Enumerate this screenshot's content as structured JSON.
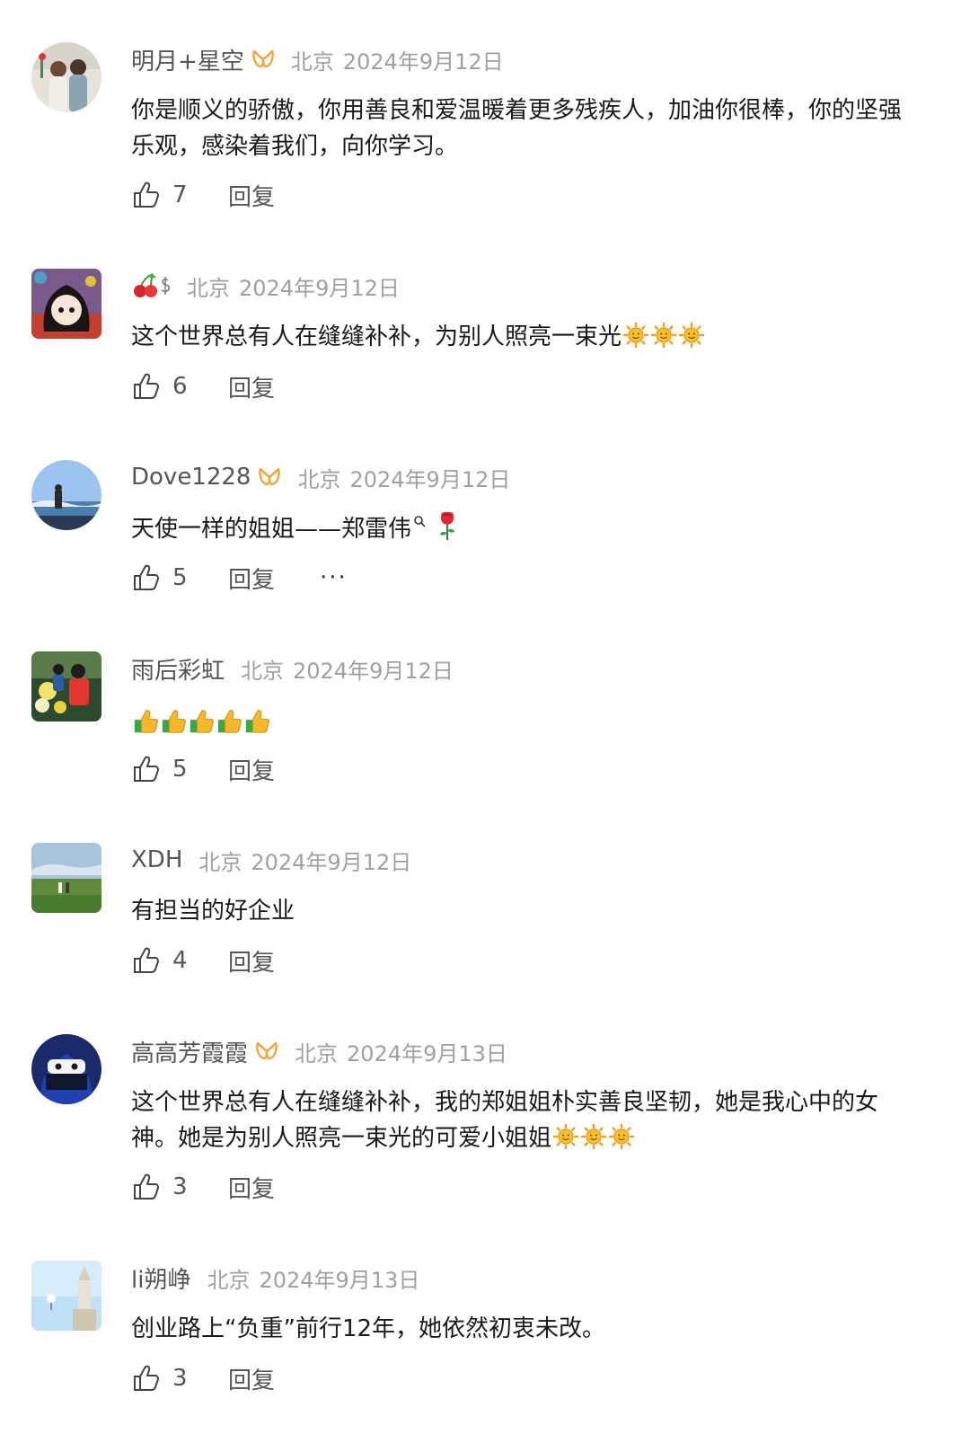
{
  "comments": [
    {
      "username": "明月+星空",
      "location": "北京",
      "date": "2024年9月12日",
      "text": "你是顺义的骄傲，你用善良和爱温暖着更多残疾人，加油你很棒，你的坚强乐观，感染着我们，向你学习。",
      "likes": "7",
      "reply": "回复"
    },
    {
      "username": "",
      "location": "北京",
      "date": "2024年9月12日",
      "text": "这个世界总有人在缝缝补补，为别人照亮一束光",
      "likes": "6",
      "reply": "回复"
    },
    {
      "username": "Dove1228",
      "location": "北京",
      "date": "2024年9月12日",
      "text": "天使一样的姐姐——郑雷伟",
      "likes": "5",
      "reply": "回复",
      "more": "···"
    },
    {
      "username": "雨后彩虹",
      "location": "北京",
      "date": "2024年9月12日",
      "text": "",
      "likes": "5",
      "reply": "回复"
    },
    {
      "username": "XDH",
      "location": "北京",
      "date": "2024年9月12日",
      "text": "有担当的好企业",
      "likes": "4",
      "reply": "回复"
    },
    {
      "username": "高高芳霞霞",
      "location": "北京",
      "date": "2024年9月13日",
      "text": "这个世界总有人在缝缝补补，我的郑姐姐朴实善良坚韧，她是我心中的女神。她是为别人照亮一束光的可爱小姐姐",
      "likes": "3",
      "reply": "回复"
    },
    {
      "username": "li朔峥",
      "location": "北京",
      "date": "2024年9月13日",
      "text": "创业路上“负重”前行12年，她依然初衷未改。",
      "likes": "3",
      "reply": "回复"
    }
  ],
  "icons": {
    "like": "thumbs-up-outline-icon",
    "vip": "vip-badge-icon",
    "sun": "sun-emoji",
    "thumb": "thumbs-up-emoji",
    "rose": "rose-emoji",
    "cherry": "cherry-emoji",
    "search": "search-superscript-icon"
  },
  "colors": {
    "vip_badge": "#f2a33a",
    "meta_gray": "#a0a0a0",
    "text_dark": "#1a1a1a"
  }
}
